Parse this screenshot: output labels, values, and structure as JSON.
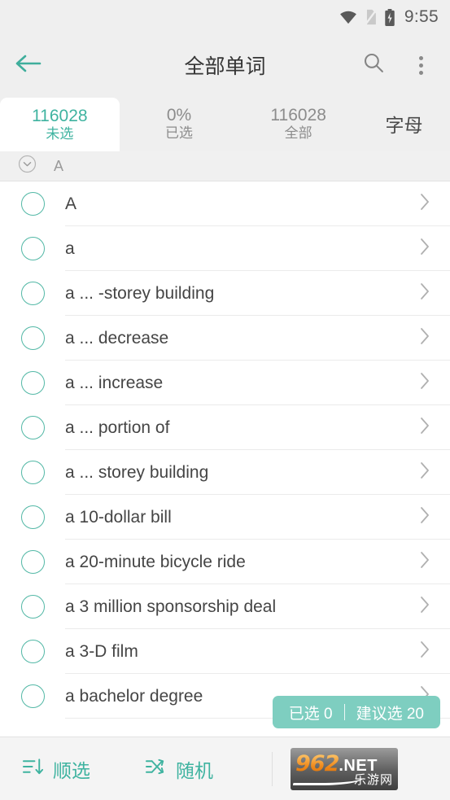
{
  "statusbar": {
    "wifi_icon": "wifi-icon",
    "sim_icon": "no-sim-icon",
    "battery_icon": "battery-charging-icon",
    "time": "9:55"
  },
  "appbar": {
    "back_icon": "back-arrow-icon",
    "title": "全部单词",
    "search_icon": "search-icon",
    "overflow_icon": "more-vertical-icon"
  },
  "tabs": [
    {
      "num": "116028",
      "label": "未选",
      "active": true
    },
    {
      "num": "0%",
      "label": "已选",
      "active": false
    },
    {
      "num": "116028",
      "label": "全部",
      "active": false
    }
  ],
  "letter_tab": {
    "label": "字母"
  },
  "section": {
    "toggle_icon": "chevron-down-circle-icon",
    "letter": "A"
  },
  "rows": [
    {
      "text": "A"
    },
    {
      "text": "a"
    },
    {
      "text": "a ... -storey building"
    },
    {
      "text": "a ... decrease"
    },
    {
      "text": "a ... increase"
    },
    {
      "text": "a ... portion of"
    },
    {
      "text": "a ... storey building"
    },
    {
      "text": "a 10-dollar bill"
    },
    {
      "text": "a 20-minute bicycle ride"
    },
    {
      "text": "a 3 million sponsorship deal"
    },
    {
      "text": "a 3-D film"
    },
    {
      "text": "a bachelor degree"
    }
  ],
  "pill": {
    "selected_label": "已选 0",
    "suggested_label": "建议选 20"
  },
  "bottombar": {
    "sequential": {
      "icon": "sort-descending-icon",
      "label": "顺选"
    },
    "random": {
      "icon": "shuffle-icon",
      "label": "随机"
    }
  },
  "watermark": {
    "main": "962",
    "tld": ".NET",
    "sub": "乐游网"
  },
  "colors": {
    "accent": "#3fb3a0",
    "pill_bg": "#7ecec0",
    "checkbox_border": "#53b8a6",
    "chrome_bg": "#efefef",
    "text_primary": "#454545",
    "text_muted": "#8c8c8c"
  }
}
